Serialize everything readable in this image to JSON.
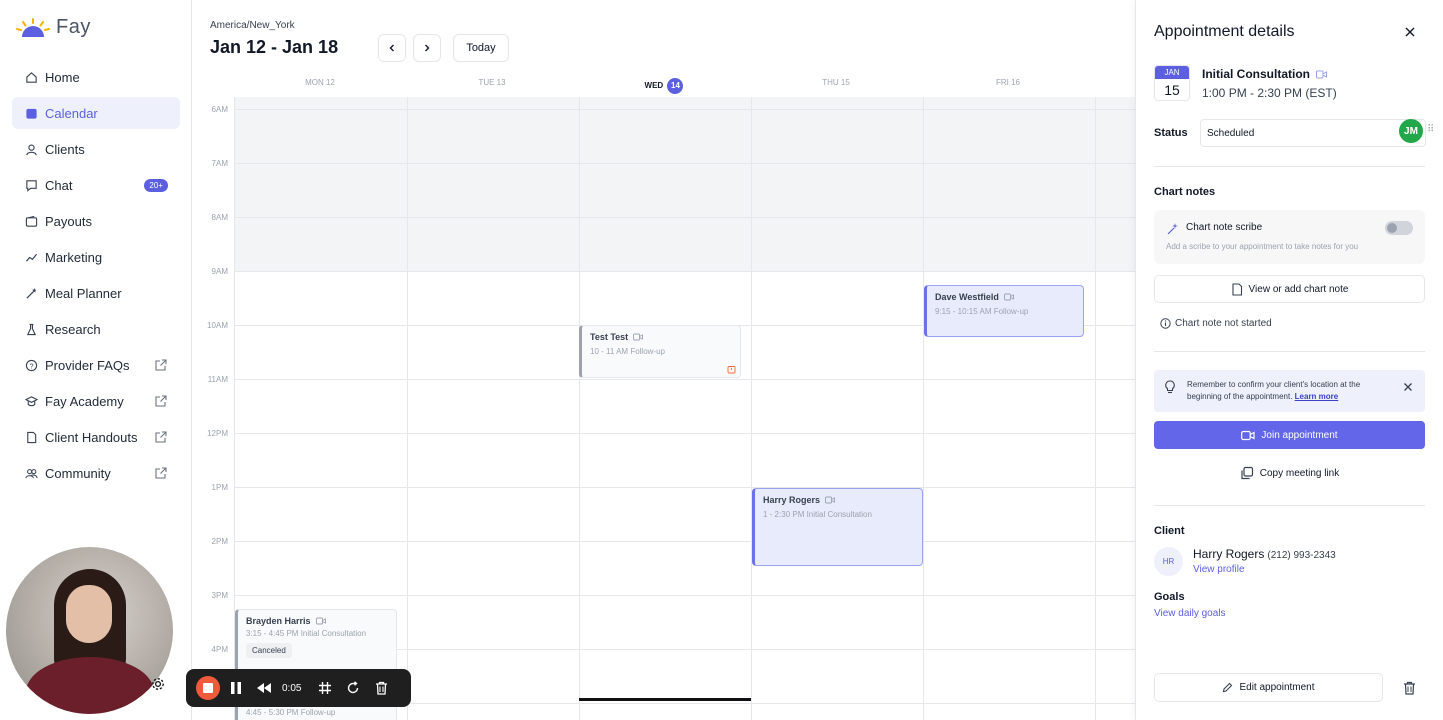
{
  "app": {
    "name": "Fay"
  },
  "sidebar": {
    "items": [
      {
        "label": "Home",
        "icon": "home-icon"
      },
      {
        "label": "Calendar",
        "icon": "calendar-icon",
        "active": true
      },
      {
        "label": "Clients",
        "icon": "user-icon"
      },
      {
        "label": "Chat",
        "icon": "chat-icon",
        "badge": "20+"
      },
      {
        "label": "Payouts",
        "icon": "wallet-icon"
      },
      {
        "label": "Marketing",
        "icon": "trend-icon"
      },
      {
        "label": "Meal Planner",
        "icon": "wand-icon"
      },
      {
        "label": "Research",
        "icon": "flask-icon"
      },
      {
        "label": "Provider FAQs",
        "icon": "help-icon",
        "external": true
      },
      {
        "label": "Fay Academy",
        "icon": "academy-icon",
        "external": true
      },
      {
        "label": "Client Handouts",
        "icon": "document-icon",
        "external": true
      },
      {
        "label": "Community",
        "icon": "community-icon",
        "external": true
      }
    ]
  },
  "recorder": {
    "time": "0:05"
  },
  "calendar": {
    "timezone": "America/New_York",
    "range": "Jan 12 - Jan 18",
    "today_label": "Today",
    "days": [
      {
        "label": "MON 12"
      },
      {
        "label": "TUE 13"
      },
      {
        "label": "WED",
        "num": "14",
        "today": true
      },
      {
        "label": "THU 15"
      },
      {
        "label": "FRI 16"
      }
    ],
    "hours": [
      "6AM",
      "7AM",
      "8AM",
      "9AM",
      "10AM",
      "11AM",
      "12PM",
      "1PM",
      "2PM",
      "3PM",
      "4PM"
    ],
    "events": [
      {
        "name": "Dave Westfield",
        "detail": "9:15 - 10:15 AM Follow-up",
        "style": "blue"
      },
      {
        "name": "Test Test",
        "detail": "10 - 11 AM Follow-up",
        "style": "gray"
      },
      {
        "name": "Harry Rogers",
        "detail": "1 - 2:30 PM Initial Consultation",
        "style": "blue"
      },
      {
        "name": "Brayden Harris",
        "detail": "3:15 - 4:45 PM Initial Consultation",
        "status": "Canceled",
        "style": "gray"
      },
      {
        "name": "",
        "detail": "4:45 - 5:30 PM Follow-up",
        "style": "gray"
      }
    ]
  },
  "panel": {
    "title": "Appointment details",
    "date_month": "JAN",
    "date_day": "15",
    "appt_name": "Initial Consultation",
    "appt_time": "1:00 PM - 2:30 PM (EST)",
    "status_label": "Status",
    "status_value": "Scheduled",
    "assignee_initials": "JM",
    "chart_notes_title": "Chart notes",
    "scribe_title": "Chart note scribe",
    "scribe_sub": "Add a scribe to your appointment to take notes for you",
    "view_chart_note": "View or add chart note",
    "note_status": "Chart note not started",
    "reminder_text": "Remember to confirm your client's location at the beginning of the appointment.",
    "reminder_link": "Learn more",
    "join_label": "Join appointment",
    "copy_link_label": "Copy meeting link",
    "client_title": "Client",
    "client_initials": "HR",
    "client_name": "Harry Rogers",
    "client_phone": "(212) 993-2343",
    "view_profile": "View profile",
    "goals_title": "Goals",
    "view_goals": "View daily goals",
    "edit_label": "Edit appointment"
  },
  "colors": {
    "accent": "#5b5fe0",
    "success": "#22a84a",
    "record": "#ef5a3a"
  }
}
